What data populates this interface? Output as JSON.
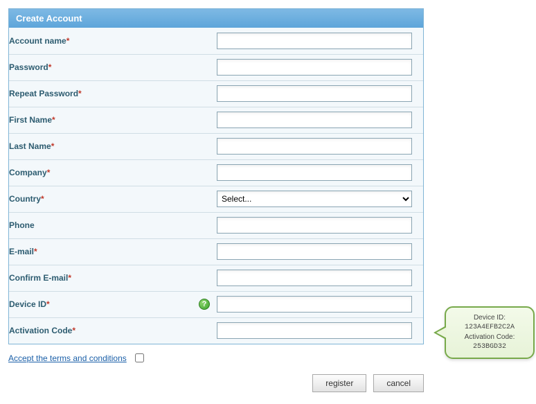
{
  "panel": {
    "title": "Create Account"
  },
  "fields": {
    "account_name": {
      "label": "Account name",
      "required": true,
      "value": ""
    },
    "password": {
      "label": "Password",
      "required": true,
      "value": ""
    },
    "repeat_password": {
      "label": "Repeat Password",
      "required": true,
      "value": ""
    },
    "first_name": {
      "label": "First Name",
      "required": true,
      "value": ""
    },
    "last_name": {
      "label": "Last Name",
      "required": true,
      "value": ""
    },
    "company": {
      "label": "Company",
      "required": true,
      "value": ""
    },
    "country": {
      "label": "Country",
      "required": true,
      "selected": "Select..."
    },
    "phone": {
      "label": "Phone",
      "required": false,
      "value": ""
    },
    "email": {
      "label": "E-mail",
      "required": true,
      "value": ""
    },
    "confirm_email": {
      "label": "Confirm E-mail",
      "required": true,
      "value": ""
    },
    "device_id": {
      "label": "Device ID",
      "required": true,
      "value": "",
      "help_glyph": "?"
    },
    "activation_code": {
      "label": "Activation Code",
      "required": true,
      "value": ""
    }
  },
  "terms": {
    "link_text": "Accept the terms and conditions",
    "checked": false
  },
  "buttons": {
    "register": "register",
    "cancel": "cancel"
  },
  "callout": {
    "line1": "Device ID:",
    "line2": "123A4EFB2C2A",
    "line3": "Activation Code:",
    "line4": "253BGD32"
  },
  "required_marker": "*"
}
